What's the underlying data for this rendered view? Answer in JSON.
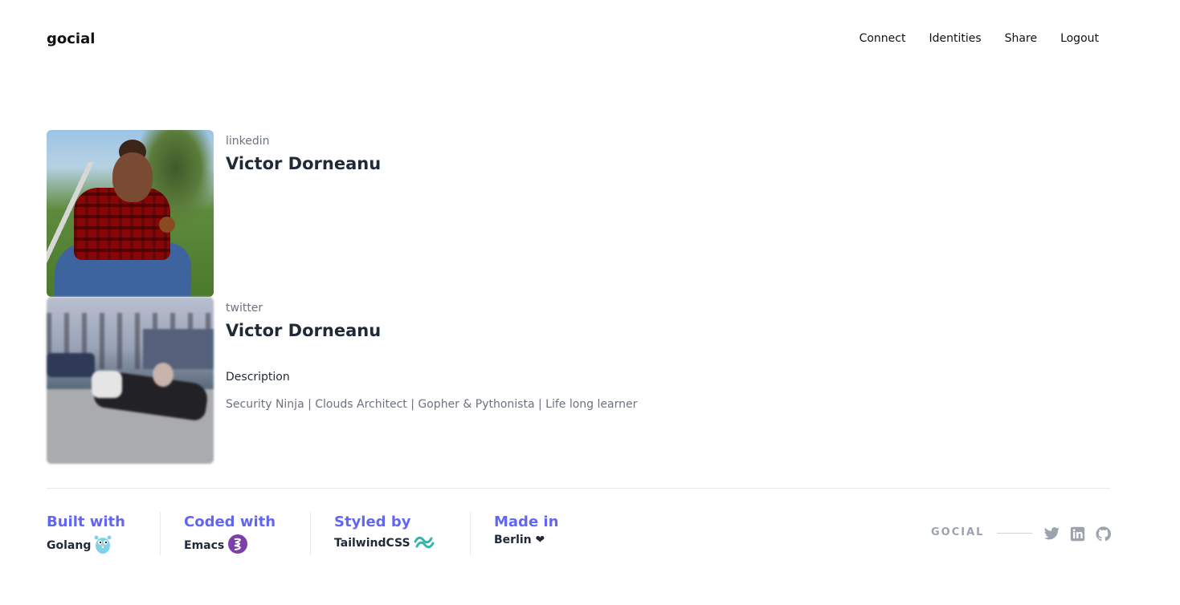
{
  "header": {
    "brand": "gocial",
    "nav": [
      "Connect",
      "Identities",
      "Share",
      "Logout"
    ]
  },
  "identities": [
    {
      "provider": "linkedin",
      "name": "Victor Dorneanu"
    },
    {
      "provider": "twitter",
      "name": "Victor Dorneanu",
      "description_label": "Description",
      "description": "Security Ninja | Clouds Architect | Gopher & Pythonista | Life long learner"
    }
  ],
  "footer": {
    "items": [
      {
        "title": "Built with",
        "value": "Golang",
        "icon": "gopher-icon"
      },
      {
        "title": "Coded with",
        "value": "Emacs",
        "icon": "emacs-icon"
      },
      {
        "title": "Styled by",
        "value": "TailwindCSS",
        "icon": "tailwind-icon"
      },
      {
        "title": "Made in",
        "value": "Berlin ❤",
        "icon": ""
      }
    ],
    "brand": "GOCIAL",
    "social_icons": [
      "twitter-icon",
      "linkedin-icon",
      "github-icon"
    ]
  },
  "colors": {
    "accent": "#6366f1",
    "muted": "#6b7280",
    "text": "#1f2937",
    "icon": "#9ca3af"
  }
}
